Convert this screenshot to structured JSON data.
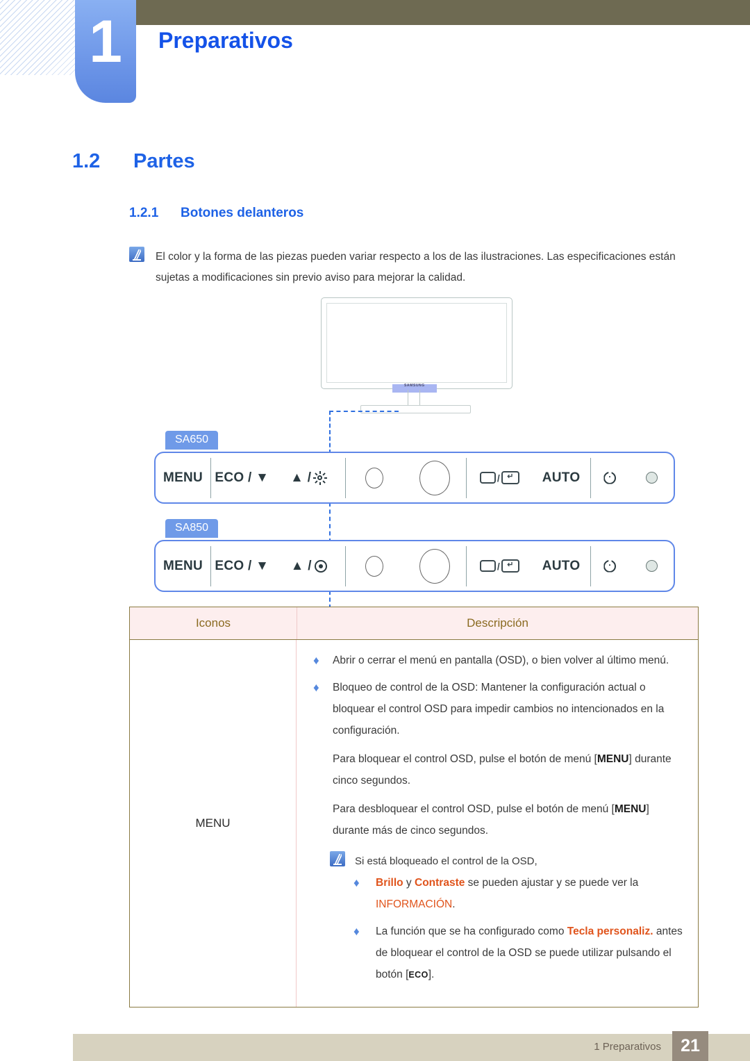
{
  "header": {
    "chapter_number": "1",
    "chapter_title": "Preparativos"
  },
  "sections": {
    "h1_number": "1.2",
    "h1_title": "Partes",
    "h2_number": "1.2.1",
    "h2_title": "Botones delanteros"
  },
  "page_note": {
    "icon": "note-icon",
    "text": "El color y la forma de las piezas pueden variar respecto a los de las ilustraciones. Las especificaciones están sujetas a modificaciones sin previo aviso para mejorar la calidad."
  },
  "monitor": {
    "brand_logo": "SAMSUNG"
  },
  "panels": [
    {
      "model": "SA650",
      "buttons": [
        {
          "label": "MENU",
          "icon": "menu-button"
        },
        {
          "label": "ECO / ▼",
          "icon": "eco-down-button"
        },
        {
          "label": "▲ /",
          "icon": "up-brightness-button",
          "glyph": "sun-icon"
        },
        {
          "label": "",
          "icon": "small-circle-button"
        },
        {
          "label": "",
          "icon": "large-circle-button"
        },
        {
          "label": "",
          "icon": "source-enter-button"
        },
        {
          "label": "AUTO",
          "icon": "auto-button"
        },
        {
          "label": "",
          "icon": "power-icon"
        },
        {
          "label": "",
          "icon": "power-led-indicator"
        }
      ]
    },
    {
      "model": "SA850",
      "buttons": [
        {
          "label": "MENU",
          "icon": "menu-button"
        },
        {
          "label": "ECO / ▼",
          "icon": "eco-down-button"
        },
        {
          "label": "▲ /",
          "icon": "up-target-button",
          "glyph": "target-icon"
        },
        {
          "label": "",
          "icon": "small-circle-button"
        },
        {
          "label": "",
          "icon": "large-circle-button"
        },
        {
          "label": "",
          "icon": "source-enter-button"
        },
        {
          "label": "AUTO",
          "icon": "auto-button"
        },
        {
          "label": "",
          "icon": "power-icon"
        },
        {
          "label": "",
          "icon": "power-led-indicator"
        }
      ]
    }
  ],
  "table": {
    "headers": {
      "icons": "Iconos",
      "description": "Descripción"
    },
    "row": {
      "icon_label": "MENU",
      "bullet_1": "Abrir o cerrar el menú en pantalla (OSD), o bien volver al último menú.",
      "bullet_2": "Bloqueo de control de la OSD: Mantener la configuración actual o bloquear el control OSD para impedir cambios no intencionados en la configuración.",
      "para_lock_pre": "Para bloquear el control OSD, pulse el botón de menú [",
      "para_lock_key": "MENU",
      "para_lock_post": "] durante cinco segundos.",
      "para_unlock_pre": "Para desbloquear el control OSD, pulse el botón de menú [",
      "para_unlock_key": "MENU",
      "para_unlock_post": "] durante más de cinco segundos.",
      "subnote_intro": "Si está bloqueado el control de la OSD,",
      "subnote_b1_t1": "Brillo",
      "subnote_b1_t2": " y ",
      "subnote_b1_t3": "Contraste",
      "subnote_b1_t4": " se pueden ajustar y se puede ver la ",
      "subnote_b1_t5": "INFORMACIÓN",
      "subnote_b1_t6": ".",
      "subnote_b2_t1": "La función que se ha configurado como ",
      "subnote_b2_t2": "Tecla personaliz.",
      "subnote_b2_t3": " antes de bloquear el control de la OSD se puede utilizar pulsando el botón [",
      "subnote_b2_key": "ECO",
      "subnote_b2_t4": "]."
    }
  },
  "footer": {
    "text": "1 Preparativos",
    "page_number": "21"
  },
  "colors": {
    "accent_blue": "#1e62e6",
    "panel_blue": "#5f87e8",
    "highlight_orange": "#e0541c",
    "table_border": "#8a7a42",
    "table_head_bg": "#fdeeee",
    "footer_bar": "#d7d2bf",
    "footer_page_box": "#968b7e",
    "header_olive": "#6e6a52"
  }
}
